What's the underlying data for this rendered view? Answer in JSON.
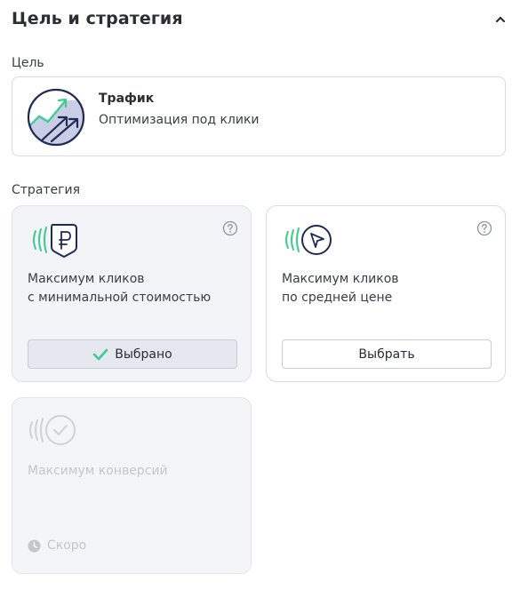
{
  "section": {
    "title": "Цель и стратегия",
    "collapse_icon": "chevron-up-icon"
  },
  "goal": {
    "label": "Цель",
    "title": "Трафик",
    "description": "Оптимизация под клики",
    "icon": "traffic-arrows-icon"
  },
  "strategy": {
    "label": "Стратегия",
    "cards": [
      {
        "line1": "Максимум кликов",
        "line2": "с минимальной стоимостью",
        "button": "Выбрано",
        "state": "selected",
        "icon": "ruble-badge-icon"
      },
      {
        "line1": "Максимум кликов",
        "line2": "по средней цене",
        "button": "Выбрать",
        "state": "default",
        "icon": "cursor-click-icon"
      },
      {
        "line1": "Максимум конверсий",
        "status": "Скоро",
        "state": "disabled",
        "icon": "check-circle-icon"
      }
    ]
  },
  "colors": {
    "accent_green": "#3ecb8e",
    "navy": "#1f2a55",
    "muted": "#c3c6cc"
  }
}
